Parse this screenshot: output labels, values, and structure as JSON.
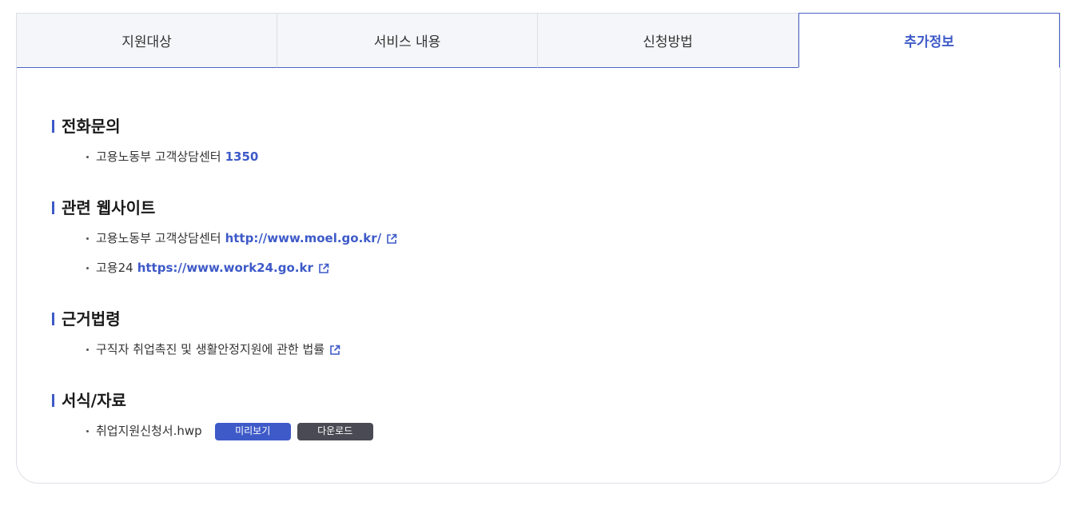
{
  "tabs": [
    {
      "label": "지원대상"
    },
    {
      "label": "서비스 내용"
    },
    {
      "label": "신청방법"
    },
    {
      "label": "추가정보"
    }
  ],
  "sections": {
    "phone": {
      "title": "전화문의",
      "items": [
        {
          "text": "고용노동부 고객상담센터",
          "number": "1350"
        }
      ]
    },
    "websites": {
      "title": "관련 웹사이트",
      "items": [
        {
          "text": "고용노동부 고객상담센터",
          "url": "http://www.moel.go.kr/"
        },
        {
          "text": "고용24",
          "url": "https://www.work24.go.kr"
        }
      ]
    },
    "laws": {
      "title": "근거법령",
      "items": [
        {
          "text": "구직자 취업촉진 및 생활안정지원에 관한 법률"
        }
      ]
    },
    "forms": {
      "title": "서식/자료",
      "items": [
        {
          "filename": "취업지원신청서.hwp",
          "preview_label": "미리보기",
          "download_label": "다운로드"
        }
      ]
    }
  },
  "colors": {
    "accent": "#3e5ac8",
    "download_button": "#4a4a54"
  },
  "icons": {
    "external_link": "external-link-icon"
  }
}
